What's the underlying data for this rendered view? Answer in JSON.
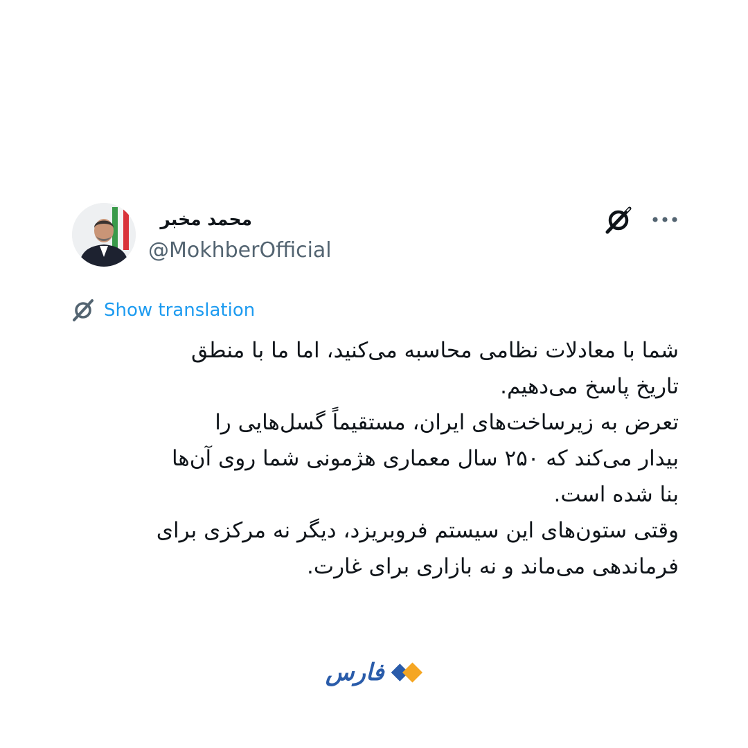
{
  "tweet": {
    "author": {
      "display_name": "محمد مخبر",
      "handle": "@MokhberOfficial",
      "avatar": "user-avatar-photo"
    },
    "header_icons": {
      "grok": "grok-icon",
      "more": "more-options-icon"
    },
    "translation": {
      "label": "Show translation",
      "icon": "translate-icon"
    },
    "body_lines": [
      "شما با معادلات نظامی محاسبه می‌کنید، اما ما با منطق",
      "تاریخ پاسخ می‌دهیم.",
      "تعرض به زیرساخت‌های ایران، مستقیماً گسل‌هایی را",
      "بیدار می‌کند که ۲۵۰ سال معماری هژمونی شما روی آن‌ها",
      "بنا شده است.",
      "وقتی ستون‌های این سیستم فروبریزد، دیگر نه مرکزی برای",
      "فرماندهی می‌ماند و نه بازاری برای غارت."
    ]
  },
  "branding": {
    "logo_text": "فارس",
    "logo_icon": "fars-logo-mark"
  },
  "colors": {
    "text_primary": "#0f1419",
    "text_secondary": "#536471",
    "link": "#1d9bf0",
    "logo_blue": "#2a5caa",
    "logo_orange": "#f5a623"
  }
}
